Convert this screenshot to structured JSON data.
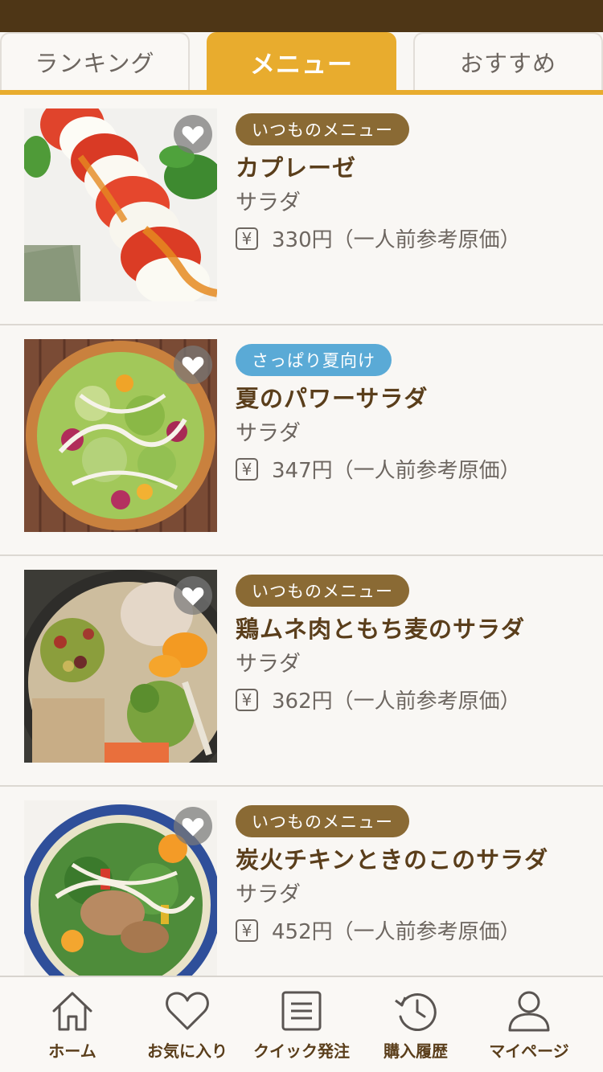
{
  "tabs": [
    {
      "label": "ランキング",
      "active": false
    },
    {
      "label": "メニュー",
      "active": true
    },
    {
      "label": "おすすめ",
      "active": false
    }
  ],
  "items": [
    {
      "badge": "いつものメニュー",
      "badge_color": "#8a6a34",
      "name": "カプレーゼ",
      "category": "サラダ",
      "price": "330円（一人前参考原価）",
      "image": "caprese-photo"
    },
    {
      "badge": "さっぱり夏向け",
      "badge_color": "#5aaad6",
      "name": "夏のパワーサラダ",
      "category": "サラダ",
      "price": "347円（一人前参考原価）",
      "image": "summer-power-salad-photo"
    },
    {
      "badge": "いつものメニュー",
      "badge_color": "#8a6a34",
      "name": "鶏ムネ肉ともち麦のサラダ",
      "category": "サラダ",
      "price": "362円（一人前参考原価）",
      "image": "chicken-barley-salad-photo"
    },
    {
      "badge": "いつものメニュー",
      "badge_color": "#8a6a34",
      "name": "炭火チキンときのこのサラダ",
      "category": "サラダ",
      "price": "452円（一人前参考原価）",
      "image": "charcoal-chicken-mushroom-salad-photo"
    }
  ],
  "yen_symbol": "¥",
  "nav": [
    {
      "label": "ホーム",
      "icon": "home-icon"
    },
    {
      "label": "お気に入り",
      "icon": "heart-icon"
    },
    {
      "label": "クイック発注",
      "icon": "list-icon"
    },
    {
      "label": "購入履歴",
      "icon": "history-icon"
    },
    {
      "label": "マイページ",
      "icon": "user-icon"
    }
  ],
  "colors": {
    "status_bar": "#4e3616",
    "accent": "#e8ac2e",
    "text_brown": "#5a3e1b",
    "background": "#f9f7f4"
  }
}
